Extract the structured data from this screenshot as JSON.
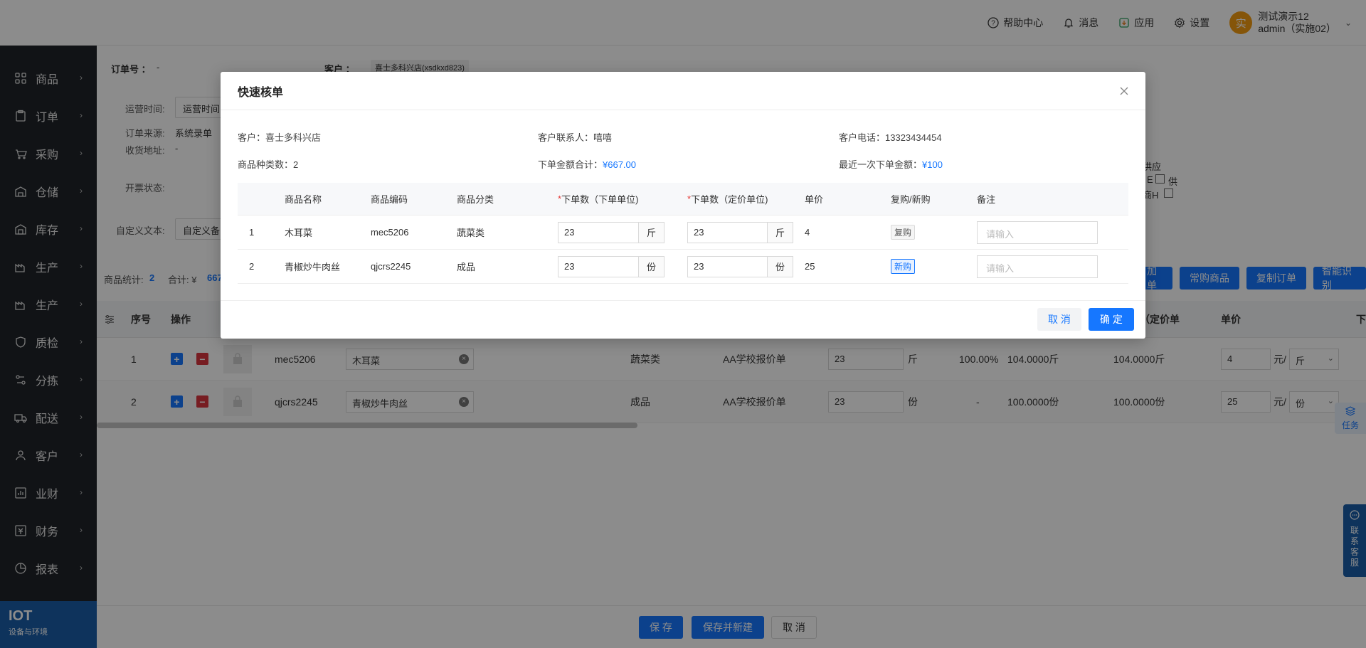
{
  "header": {
    "help": "帮助中心",
    "messages": "消息",
    "apps": "应用",
    "settings": "设置",
    "user_avatar": "实",
    "user_name": "测试演示12",
    "user_role": "admin（实施02）"
  },
  "sidebar": {
    "items": [
      {
        "label": "商品",
        "icon": "grid-icon"
      },
      {
        "label": "订单",
        "icon": "clipboard-icon"
      },
      {
        "label": "采购",
        "icon": "cart-icon"
      },
      {
        "label": "仓储",
        "icon": "warehouse-icon"
      },
      {
        "label": "库存",
        "icon": "inventory-icon"
      },
      {
        "label": "生产",
        "icon": "factory-icon"
      },
      {
        "label": "生产",
        "icon": "factory-icon"
      },
      {
        "label": "质检",
        "icon": "shield-icon"
      },
      {
        "label": "分拣",
        "icon": "sort-icon"
      },
      {
        "label": "配送",
        "icon": "truck-icon"
      },
      {
        "label": "客户",
        "icon": "user-icon"
      },
      {
        "label": "业财",
        "icon": "chart-icon"
      },
      {
        "label": "财务",
        "icon": "finance-icon"
      },
      {
        "label": "报表",
        "icon": "report-icon"
      }
    ],
    "iot_title": "IOT",
    "iot_sub": "设备与环境"
  },
  "page": {
    "order_no_label": "订单号 ：",
    "order_no_value": "-",
    "customer_label": "客户 ：",
    "customer_tag": "喜士多科兴店(xsdkxd823)",
    "op_time_label": "运营时间:",
    "op_time_value": "运营时间",
    "source_label": "订单来源:",
    "source_value": "系统录单",
    "addr_label": "收货地址:",
    "addr_value": "-",
    "invoice_label": "开票状态:",
    "custom_label": "自定义文本:",
    "custom_value": "自定义备",
    "supply_a": "供应",
    "supply_b": "E",
    "supply_c": "供",
    "supply_d": "商H",
    "stats_label": "商品统计:",
    "stats_value": "2",
    "total_label": "合计: ¥",
    "total_value": "667",
    "btn_add": "加单",
    "btn_common": "常购商品",
    "btn_copy": "复制订单",
    "btn_ai": "智能识别"
  },
  "grid": {
    "headers": {
      "seq": "序号",
      "op": "操作",
      "stock": "存（定价单",
      "price": "单价",
      "down": "下"
    },
    "rows": [
      {
        "seq": "1",
        "code": "mec5206",
        "name": "木耳菜",
        "category": "蔬菜类",
        "quote": "AA学校报价单",
        "qty": "23",
        "unit": "斤",
        "rate": "100.00%",
        "std": "104.0000斤",
        "stock": "104.0000斤",
        "price": "4",
        "price_unit": "元/",
        "unit_sel": "斤"
      },
      {
        "seq": "2",
        "code": "qjcrs2245",
        "name": "青椒炒牛肉丝",
        "category": "成品",
        "quote": "AA学校报价单",
        "qty": "23",
        "unit": "份",
        "rate": "-",
        "std": "100.0000份",
        "stock": "100.0000份",
        "price": "25",
        "price_unit": "元/",
        "unit_sel": "份"
      }
    ]
  },
  "footer": {
    "save": "保 存",
    "save_new": "保存并新建",
    "cancel": "取 消"
  },
  "float": {
    "task": "任务",
    "service": [
      "联",
      "系",
      "客",
      "服"
    ]
  },
  "modal": {
    "title": "快速核单",
    "customer_label": "客户：",
    "customer_value": "喜士多科兴店",
    "contact_label": "客户联系人：",
    "contact_value": "嘻嘻",
    "phone_label": "客户电话：",
    "phone_value": "13323434454",
    "kinds_label": "商品种类数：",
    "kinds_value": "2",
    "amount_label": "下单金额合计：",
    "amount_value": "¥667.00",
    "last_label": "最近一次下单金额：",
    "last_value": "¥100",
    "columns": [
      "",
      "商品名称",
      "商品编码",
      "商品分类",
      "下单数（下单单位)",
      "下单数（定价单位)",
      "单价",
      "复购/新购",
      "备注"
    ],
    "rows": [
      {
        "seq": "1",
        "name": "木耳菜",
        "code": "mec5206",
        "category": "蔬菜类",
        "qty1": "23",
        "unit1": "斤",
        "qty2": "23",
        "unit2": "斤",
        "price": "4",
        "buy_type": "复购",
        "note_placeholder": "请输入"
      },
      {
        "seq": "2",
        "name": "青椒炒牛肉丝",
        "code": "qjcrs2245",
        "category": "成品",
        "qty1": "23",
        "unit1": "份",
        "qty2": "23",
        "unit2": "份",
        "price": "25",
        "buy_type": "新购",
        "note_placeholder": "请输入"
      }
    ],
    "cancel": "取 消",
    "ok": "确 定"
  },
  "colors": {
    "primary": "#1677ff",
    "sidebar": "#1f2329",
    "required": "#e53935",
    "danger": "#d9363e"
  }
}
